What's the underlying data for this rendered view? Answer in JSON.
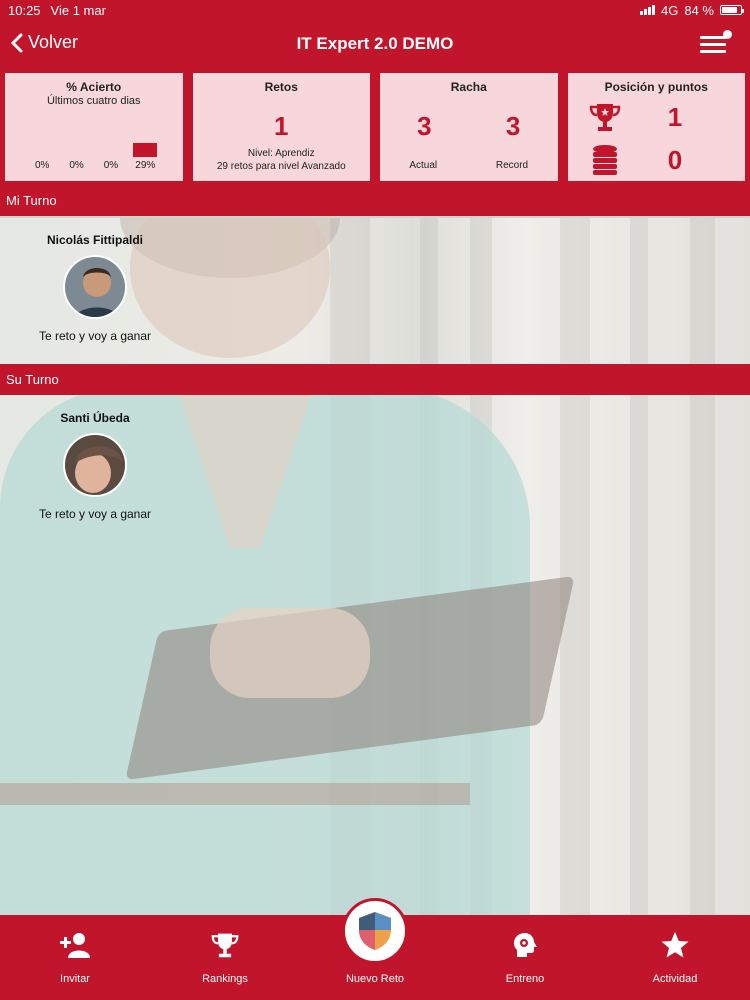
{
  "status": {
    "time": "10:25",
    "date": "Vie 1 mar",
    "network": "4G",
    "battery": "84 %",
    "battery_level": 0.84
  },
  "nav": {
    "back_label": "Volver",
    "title": "IT Expert 2.0 DEMO"
  },
  "stats": {
    "accuracy": {
      "title": "% Acierto",
      "subtitle": "Últimos cuatro dias",
      "bars": [
        {
          "label": "0%",
          "value": 0
        },
        {
          "label": "0%",
          "value": 0
        },
        {
          "label": "0%",
          "value": 0
        },
        {
          "label": "29%",
          "value": 29
        }
      ]
    },
    "retos": {
      "title": "Retos",
      "value": "1",
      "level": "Nivel: Aprendiz",
      "next": "29 retos para nivel Avanzado"
    },
    "racha": {
      "title": "Racha",
      "actual_value": "3",
      "record_value": "3",
      "actual_label": "Actual",
      "record_label": "Record"
    },
    "position": {
      "title": "Posición y puntos",
      "rank": "1",
      "points": "0"
    }
  },
  "sections": {
    "mine": "Mi Turno",
    "theirs": "Su Turno"
  },
  "players": {
    "mine": {
      "name": "Nicolás Fittipaldi",
      "message": "Te reto y voy a ganar"
    },
    "theirs": {
      "name": "Santi Úbeda",
      "message": "Te reto y voy a ganar"
    }
  },
  "tabs": {
    "invite": "Invitar",
    "rankings": "Rankings",
    "new_challenge": "Nuevo Reto",
    "training": "Entreno",
    "activity": "Actividad"
  },
  "colors": {
    "brand": "#c0152a",
    "card_bg": "#f7d6dc"
  }
}
